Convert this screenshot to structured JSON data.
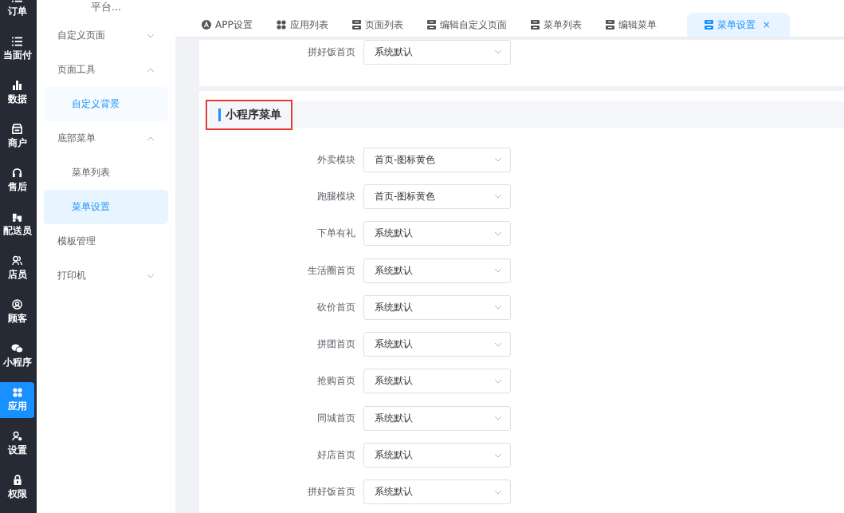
{
  "nav": {
    "items": [
      {
        "label": "订单",
        "selected": false
      },
      {
        "label": "当面付",
        "selected": false
      },
      {
        "label": "数据",
        "selected": false
      },
      {
        "label": "商户",
        "selected": false
      },
      {
        "label": "售后",
        "selected": false
      },
      {
        "label": "配送员",
        "selected": false
      },
      {
        "label": "店员",
        "selected": false
      },
      {
        "label": "顾客",
        "selected": false
      },
      {
        "label": "小程序",
        "selected": false
      },
      {
        "label": "应用",
        "selected": true
      },
      {
        "label": "设置",
        "selected": false
      },
      {
        "label": "权限",
        "selected": false
      }
    ]
  },
  "sidebar": {
    "header": "平台...",
    "items": [
      {
        "label": "自定义页面",
        "expanded": false
      },
      {
        "label": "页面工具",
        "expanded": true,
        "children": [
          {
            "label": "自定义背景",
            "selected": false,
            "hovered": true
          }
        ]
      },
      {
        "label": "底部菜单",
        "expanded": true,
        "children": [
          {
            "label": "菜单列表",
            "selected": false,
            "hovered": false
          },
          {
            "label": "菜单设置",
            "selected": true
          }
        ]
      },
      {
        "label": "模板管理"
      },
      {
        "label": "打印机",
        "expanded": false
      }
    ]
  },
  "tabs": [
    {
      "label": "APP设置",
      "selected": false
    },
    {
      "label": "应用列表",
      "selected": false
    },
    {
      "label": "页面列表",
      "selected": false
    },
    {
      "label": "编辑自定义页面",
      "selected": false
    },
    {
      "label": "菜单列表",
      "selected": false
    },
    {
      "label": "编辑菜单",
      "selected": false
    },
    {
      "label": "菜单设置",
      "selected": true,
      "close": "×"
    }
  ],
  "top_fields": [
    {
      "label": "拼好饭首页",
      "value": "系统默认"
    }
  ],
  "section": {
    "title": "小程序菜单",
    "highlighted": true,
    "fields": [
      {
        "label": "外卖模块",
        "value": "首页-图标黄色"
      },
      {
        "label": "跑腿模块",
        "value": "首页-图标黄色"
      },
      {
        "label": "下单有礼",
        "value": "系统默认"
      },
      {
        "label": "生活圈首页",
        "value": "系统默认"
      },
      {
        "label": "砍价首页",
        "value": "系统默认"
      },
      {
        "label": "拼团首页",
        "value": "系统默认"
      },
      {
        "label": "抢购首页",
        "value": "系统默认"
      },
      {
        "label": "同城首页",
        "value": "系统默认"
      },
      {
        "label": "好店首页",
        "value": "系统默认"
      },
      {
        "label": "拼好饭首页",
        "value": "系统默认"
      }
    ]
  }
}
